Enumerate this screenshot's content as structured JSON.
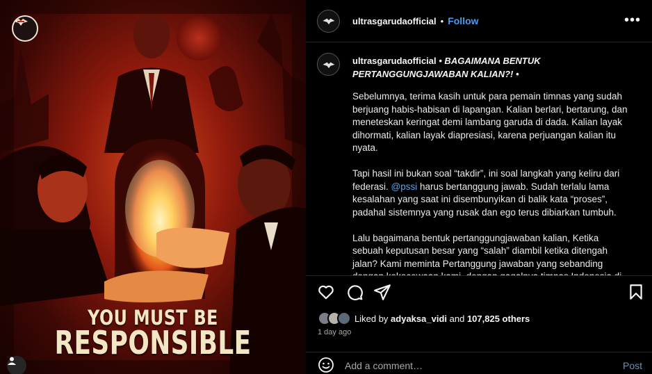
{
  "post": {
    "username": "ultrasgarudaofficial",
    "separator": "•",
    "follow_label": "Follow",
    "more_label": "•••",
    "poster_text": {
      "line1": "YOU MUST BE",
      "line2": "RESPONSIBLE"
    }
  },
  "caption": {
    "username": "ultrasgarudaofficial",
    "headline": "• BAGAIMANA BENTUK PERTANGGUNGJAWABAN KALIAN?! •",
    "para1": "Sebelumnya, terima kasih untuk para pemain timnas yang sudah berjuang habis-habisan di lapangan. Kalian berlari, bertarung, dan meneteskan keringat demi lambang garuda di dada. Kalian layak dihormati, kalian layak diapresiasi, karena perjuangan kalian itu nyata.",
    "para2_a": "Tapi hasil ini bukan soal “takdir”, ini soal langkah yang keliru dari federasi. ",
    "para2_mention": "@pssi",
    "para2_b": " harus bertanggung jawab. Sudah terlalu lama kesalahan yang saat ini disembunyikan di balik kata “proses”, padahal sistemnya yang rusak dan ego terus dibiarkan tumbuh.",
    "para3": "Lalu bagaimana bentuk pertanggungjawaban kalian, Ketika sebuah keputusan besar yang “salah” diambil ketika ditengah jalan? Kami meminta Pertanggung jawaban yang sebanding dengan kekecewaan kami, dengan gagalnya timnas Indonesia di"
  },
  "likes": {
    "prefix": "Liked by",
    "user": "adyaksa_vidi",
    "and": "and",
    "count": "107,825 others"
  },
  "time_ago": "1 day ago",
  "comment": {
    "placeholder": "Add a comment…",
    "post_label": "Post"
  },
  "icons": [
    "heart-icon",
    "comment-icon",
    "share-icon",
    "bookmark-icon",
    "emoji-icon",
    "more-icon",
    "user-tag-icon"
  ],
  "colors": {
    "link": "#4a9cf0",
    "background": "#000000",
    "muted": "#a8a8a8",
    "poster_red": "#8e1a0c"
  }
}
